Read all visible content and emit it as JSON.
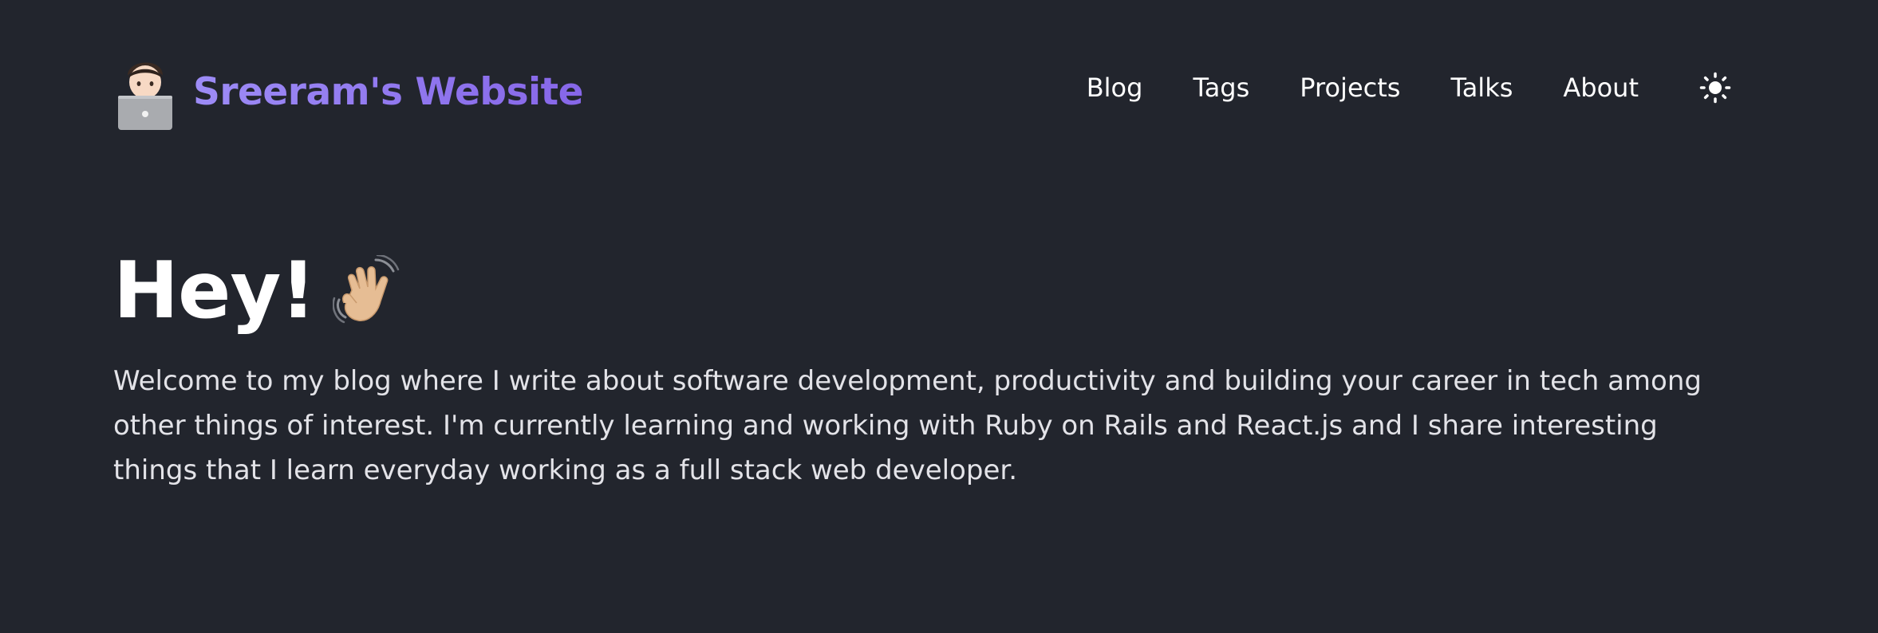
{
  "header": {
    "brand_title": "Sreeram's Website",
    "brand_icon": "technologist-emoji-icon",
    "brand_gradient": [
      "#9d8cf6",
      "#8666e8"
    ],
    "nav": [
      {
        "label": "Blog"
      },
      {
        "label": "Tags"
      },
      {
        "label": "Projects"
      },
      {
        "label": "Talks"
      },
      {
        "label": "About"
      }
    ],
    "theme_toggle_icon": "sun-icon"
  },
  "hero": {
    "title": "Hey!",
    "title_icon": "waving-hand-emoji-icon",
    "intro": "Welcome to my blog where I write about software development, productivity and building your career in tech among other things of interest. I'm currently learning and working with Ruby on Rails and React.js and I share interesting things that I learn everyday working as a full stack web developer."
  },
  "colors": {
    "background": "#22252d",
    "text": "#ffffff",
    "body_text": "#e3e3e8"
  }
}
